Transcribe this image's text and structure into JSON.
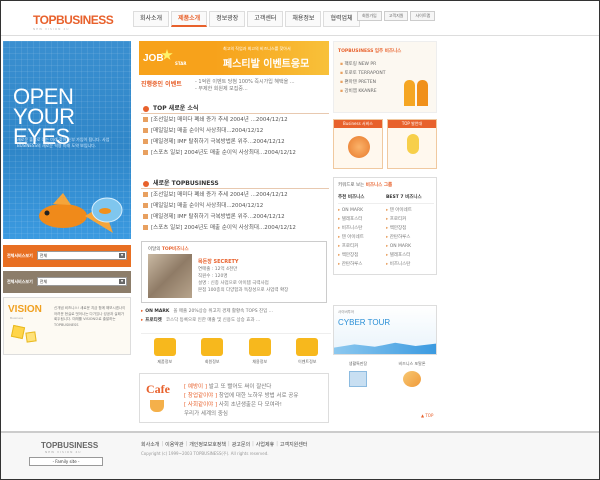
{
  "brand": {
    "logo": "TOPBUSINESS",
    "tagline": "NEW VISION 4U"
  },
  "top_nav": [
    "회사소개",
    "제품소개",
    "정보광장",
    "고객센터",
    "채용정보",
    "협력업체"
  ],
  "util_nav": [
    "회원가입",
    "고객지원",
    "사이트맵"
  ],
  "hero": {
    "headline_line1": "OPEN",
    "headline_line2": "YOUR EYES",
    "copy": "새로운 출발로 여는 미래 찾아 눈부 가입이 됩니다. 사업 BUSINESS의 새로운 혁명 미래 도약 보입니다."
  },
  "left_search": [
    {
      "label": "전체서비스보기",
      "value": "전체"
    },
    {
      "label": "전체서비스보기",
      "value": "전체"
    }
  ],
  "vision": {
    "title": "VISION",
    "subtitle": "Business",
    "text": "신개념 비즈니스! 새로운 지금 함께 해보시겠나이 어려운 현실로 벗어나는 다가있나 성공과 실패가 회두됩니다. 미래를 VISION으로 출발하는 TOPBUSINESS"
  },
  "banner": {
    "job": "JOB",
    "star": "STAR",
    "sub": "최고의 직업과 최고의 비즈니스를 찾아서",
    "title": "페스티발 이벤트응모"
  },
  "event": {
    "label": "진행중인 이벤트",
    "lines": [
      "- 1억원 이벤트 당첨 100% 즉시가입 혜택을 ...",
      "- 무제한 회원제 모집중..."
    ]
  },
  "top_news": {
    "title": "TOP 새로운 소식",
    "items": [
      "[조선일보] 매미다 폐쇄 증가 추세 2004년 ...2004/12/12",
      "[매일일보] 매출 순이익 사상최대...2004/12/12",
      "[매일경제] IMF 탈취하기 극복방법론 위주...2004/12/12",
      "[스포츠 일보] 2004년도 매출 순이익 사상최대...2004/12/12"
    ]
  },
  "new_news": {
    "title": "새로운 TOPBUSINESS",
    "items": [
      "[조선일보] 매미다 폐쇄 증가 추세 2004년 ...2004/12/12",
      "[매일일보] 매출 순이익 사상최대...2004/12/12",
      "[매일경제] IMF 탈취하기 극복방법론 위주...2004/12/12",
      "[스포츠 일보] 2004년도 매출 순이익 사상최대...2004/12/12"
    ]
  },
  "business": {
    "header_prefix": "이달의",
    "header_highlight": "TOP비즈니스",
    "name": "목돈장 SECRETY",
    "lines": [
      "연매출 : 12억 4천만",
      "직원수 : 120명",
      "설명 : 신종 사업으로 아이템 극력사업",
      "본점 100종의 다양함과 독창성으로 사업력 확장"
    ]
  },
  "marks": [
    {
      "label": "ON MARK",
      "text": "올 매출 20%상승 위고지 경제 활황속 TOPS 진입 ..."
    },
    {
      "label": "프로티켓",
      "text": "코스닥 등록으로 인한 매출 및 신용도 상승 효과 ..."
    }
  ],
  "icon_links": [
    "제품정보",
    "회원정보",
    "채용정보",
    "이벤트정보"
  ],
  "cafe": {
    "title": "Cafe",
    "lines": [
      {
        "tag": "[ 예방이 ]",
        "text": " 발고 또 빨어도 써이 잘산다"
      },
      {
        "tag": "[ 창업같이야 ]",
        "text": " 창업에 대한 노하우 방법 서로 공유"
      },
      {
        "tag": "[ 사회같이야 ]",
        "text": " 사회 초년생출은 다 모여라!"
      },
      {
        "tag": "",
        "text": "우리가 세계의 중심"
      }
    ]
  },
  "partner": {
    "title": "TOPBUSINESS 입주 비즈니스",
    "items": [
      "팩토링 NEW PR",
      "토로토 TERRAPONT",
      "편마텐 PRETEN",
      "강비엠 KKANRE"
    ]
  },
  "tiles": [
    {
      "label": "Business 서비스"
    },
    {
      "label": "TOP 발언대"
    }
  ],
  "brand_box": {
    "title_prefix": "키워드로 보는",
    "title_highlight": "비즈니스 그룹",
    "col1_title": "추천 비즈니스",
    "col2_title": "BEST 7 비즈니스",
    "col1": [
      "ON MARK",
      "텔레포스터",
      "비즈니스탄",
      "텐 아이네트",
      "프로티커",
      "백만장점",
      "잔탄하루스"
    ],
    "col2": [
      "텐 아이네트",
      "프로티커",
      "백만장점",
      "잔탄하루스",
      "ON MARK",
      "텔레포스터",
      "비즈니스탄"
    ]
  },
  "cyber": {
    "small": "사이버투어",
    "title": "CYBER TOUR"
  },
  "mini_links": [
    "생활특판장",
    "비즈니스 포탈론"
  ],
  "top_button": "TOP",
  "footer": {
    "logo": "TOPBUSINESS",
    "tagline": "NEW VISION 4U",
    "family_site": "- Family site -",
    "links": [
      "회사소개",
      "이용약관",
      "개인정보보호정책",
      "광고문의",
      "사업제휴",
      "고객지원센터"
    ],
    "copyright": "Copyright (c) 1999~2003 TOPBUSINESS(주). All rights reserved."
  }
}
